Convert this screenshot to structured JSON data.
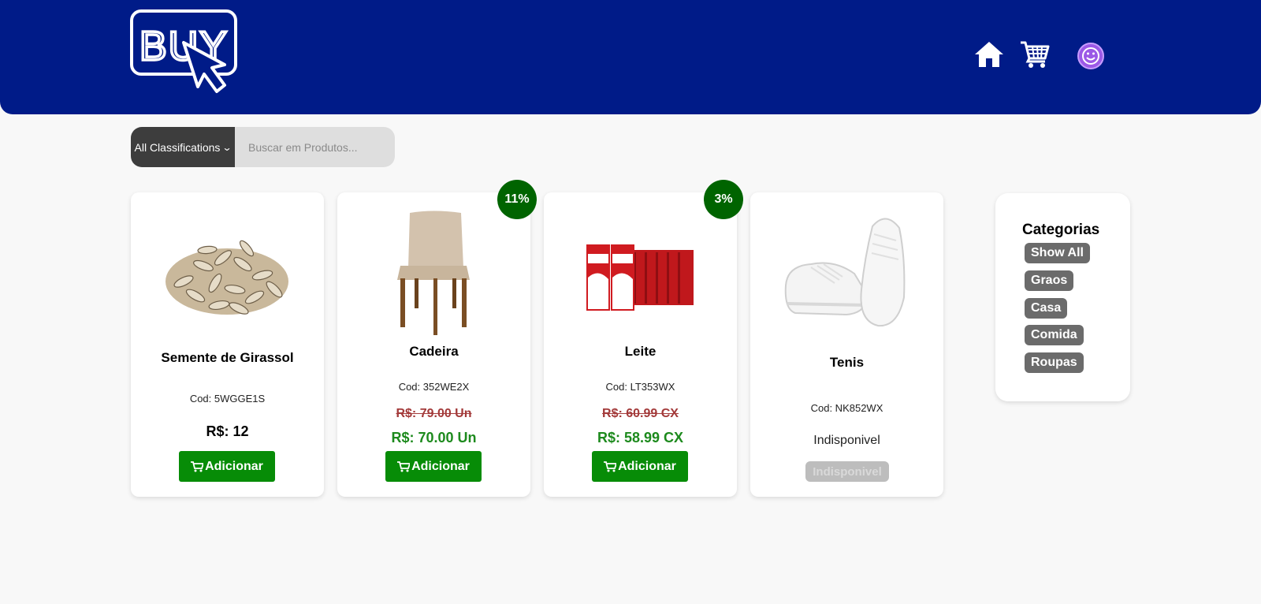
{
  "brand": {
    "logo_text": "BUY"
  },
  "header": {
    "bg_color": "#001b88",
    "nav_icons": [
      "home-icon",
      "cart-icon",
      "smiley-avatar-icon"
    ]
  },
  "search": {
    "select_label": "All Classifications",
    "placeholder": "Buscar em Produtos..."
  },
  "products": [
    {
      "name": "Semente de Girassol",
      "code": "Cod: 5WGGE1S",
      "price": "R$: 12",
      "button": "Adicionar",
      "image": "sunflower-seeds"
    },
    {
      "name": "Cadeira",
      "code": "Cod: 352WE2X",
      "discount": "11%",
      "old_price": "R$: 79.00 Un",
      "new_price": "R$: 70.00 Un",
      "button": "Adicionar",
      "image": "chair"
    },
    {
      "name": "Leite",
      "code": "Cod: LT353WX",
      "discount": "3%",
      "old_price": "R$: 60.99 CX",
      "new_price": "R$: 58.99 CX",
      "button": "Adicionar",
      "image": "milk-boxes"
    },
    {
      "name": "Tenis",
      "code": "Cod: NK852WX",
      "status": "Indisponivel",
      "button": "Indisponivel",
      "image": "white-sneakers"
    }
  ],
  "categories": {
    "title": "Categorias",
    "items": [
      "Show All",
      "Graos",
      "Casa",
      "Comida",
      "Roupas"
    ]
  },
  "colors": {
    "add_button": "#078c07",
    "discount_badge": "#006400",
    "old_price": "#a33a3a",
    "new_price": "#1d8a1d"
  }
}
